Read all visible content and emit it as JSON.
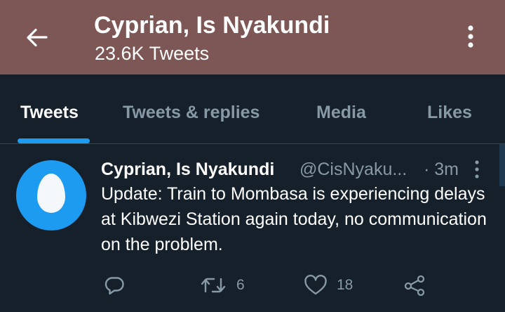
{
  "header": {
    "title": "Cyprian, Is Nyakundi",
    "subtitle": "23.6K Tweets",
    "back_icon": "back-arrow-icon",
    "menu_icon": "more-vertical-icon",
    "background_color": "#7c5756"
  },
  "tabs": [
    {
      "label": "Tweets",
      "active": true
    },
    {
      "label": "Tweets & replies",
      "active": false
    },
    {
      "label": "Media",
      "active": false
    },
    {
      "label": "Likes",
      "active": false
    }
  ],
  "tweet": {
    "name": "Cyprian, Is Nyakundi",
    "handle": "@CisNyaku...",
    "time": "· 3m",
    "text": "Update: Train to Mombasa is experiencing delays at Kibwezi Station again today, no communication on the problem.",
    "avatar_icon": "default-egg-avatar",
    "actions": {
      "reply": {
        "icon": "reply-icon",
        "count": ""
      },
      "retweet": {
        "icon": "retweet-icon",
        "count": "6"
      },
      "like": {
        "icon": "heart-icon",
        "count": "18"
      },
      "share": {
        "icon": "share-icon",
        "count": ""
      }
    }
  },
  "colors": {
    "background": "#15202b",
    "accent": "#1d9bf0",
    "secondary_text": "#8899a6"
  }
}
